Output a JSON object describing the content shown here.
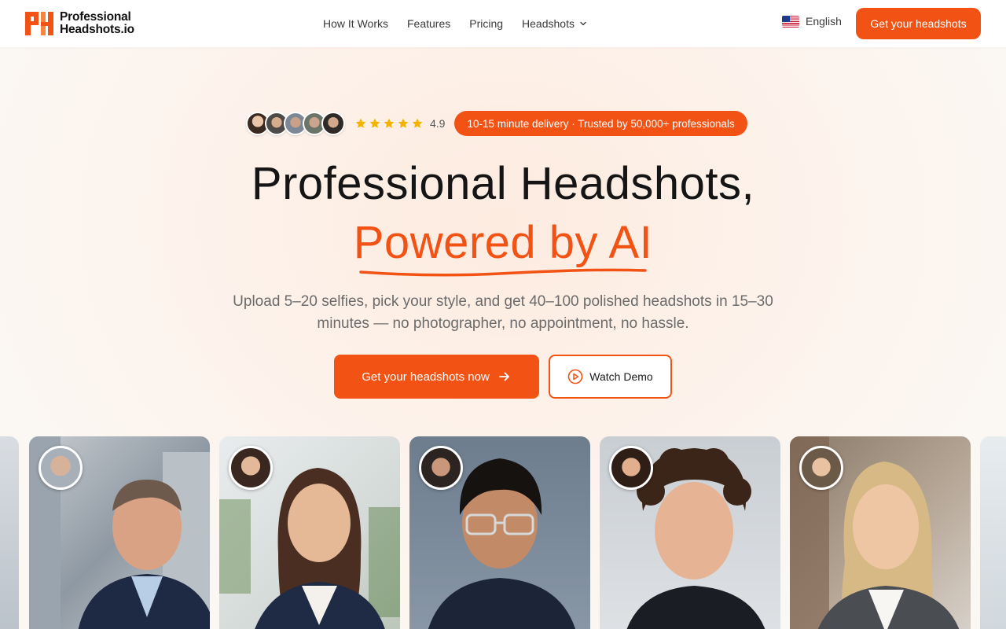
{
  "header": {
    "logo_line1": "Professional",
    "logo_line2": "Headshots.io",
    "nav": [
      {
        "label": "How It Works"
      },
      {
        "label": "Features"
      },
      {
        "label": "Pricing"
      },
      {
        "label": "Headshots",
        "has_dropdown": true
      }
    ],
    "language": "English",
    "cta": "Get your headshots"
  },
  "trust": {
    "rating": "4.9",
    "stars": 5,
    "badge": "10-15 minute delivery · Trusted by 50,000+ professionals"
  },
  "hero": {
    "title": "Professional Headshots,",
    "title_accent": "Powered by AI",
    "subtitle": "Upload 5–20 selfies, pick your style, and get 40–100 polished headshots in 15–30 minutes — no photographer, no appointment, no hassle.",
    "primary_cta": "Get your headshots now",
    "secondary_cta": "Watch Demo"
  },
  "colors": {
    "accent": "#f25314",
    "star": "#f5b301"
  },
  "icons": {
    "arrow": "arrow-right-icon",
    "play": "play-circle-icon",
    "chevron": "chevron-down-icon",
    "flag": "us-flag-icon"
  }
}
